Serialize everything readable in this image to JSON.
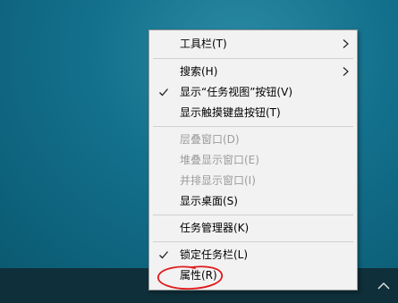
{
  "context_menu": {
    "items": [
      {
        "label": "工具栏(T)",
        "checked": false,
        "disabled": false,
        "submenu": true
      },
      {
        "label": "搜索(H)",
        "checked": false,
        "disabled": false,
        "submenu": true
      },
      {
        "label": "显示“任务视图”按钮(V)",
        "checked": true,
        "disabled": false,
        "submenu": false
      },
      {
        "label": "显示触摸键盘按钮(T)",
        "checked": false,
        "disabled": false,
        "submenu": false
      },
      {
        "label": "层叠窗口(D)",
        "checked": false,
        "disabled": true,
        "submenu": false
      },
      {
        "label": "堆叠显示窗口(E)",
        "checked": false,
        "disabled": true,
        "submenu": false
      },
      {
        "label": "并排显示窗口(I)",
        "checked": false,
        "disabled": true,
        "submenu": false
      },
      {
        "label": "显示桌面(S)",
        "checked": false,
        "disabled": false,
        "submenu": false
      },
      {
        "label": "任务管理器(K)",
        "checked": false,
        "disabled": false,
        "submenu": false
      },
      {
        "label": "锁定任务栏(L)",
        "checked": true,
        "disabled": false,
        "submenu": false
      },
      {
        "label": "属性(R)",
        "checked": false,
        "disabled": false,
        "submenu": false
      }
    ]
  },
  "annotation": {
    "color": "#e0191b"
  },
  "colors": {
    "menu_bg": "#f2f2f2",
    "disabled_text": "#9c9c9c",
    "taskbar": "#0f2f3a"
  },
  "icons": {
    "check": "check-icon",
    "submenu": "chevron-right-icon",
    "tray": "chevron-up-icon"
  }
}
